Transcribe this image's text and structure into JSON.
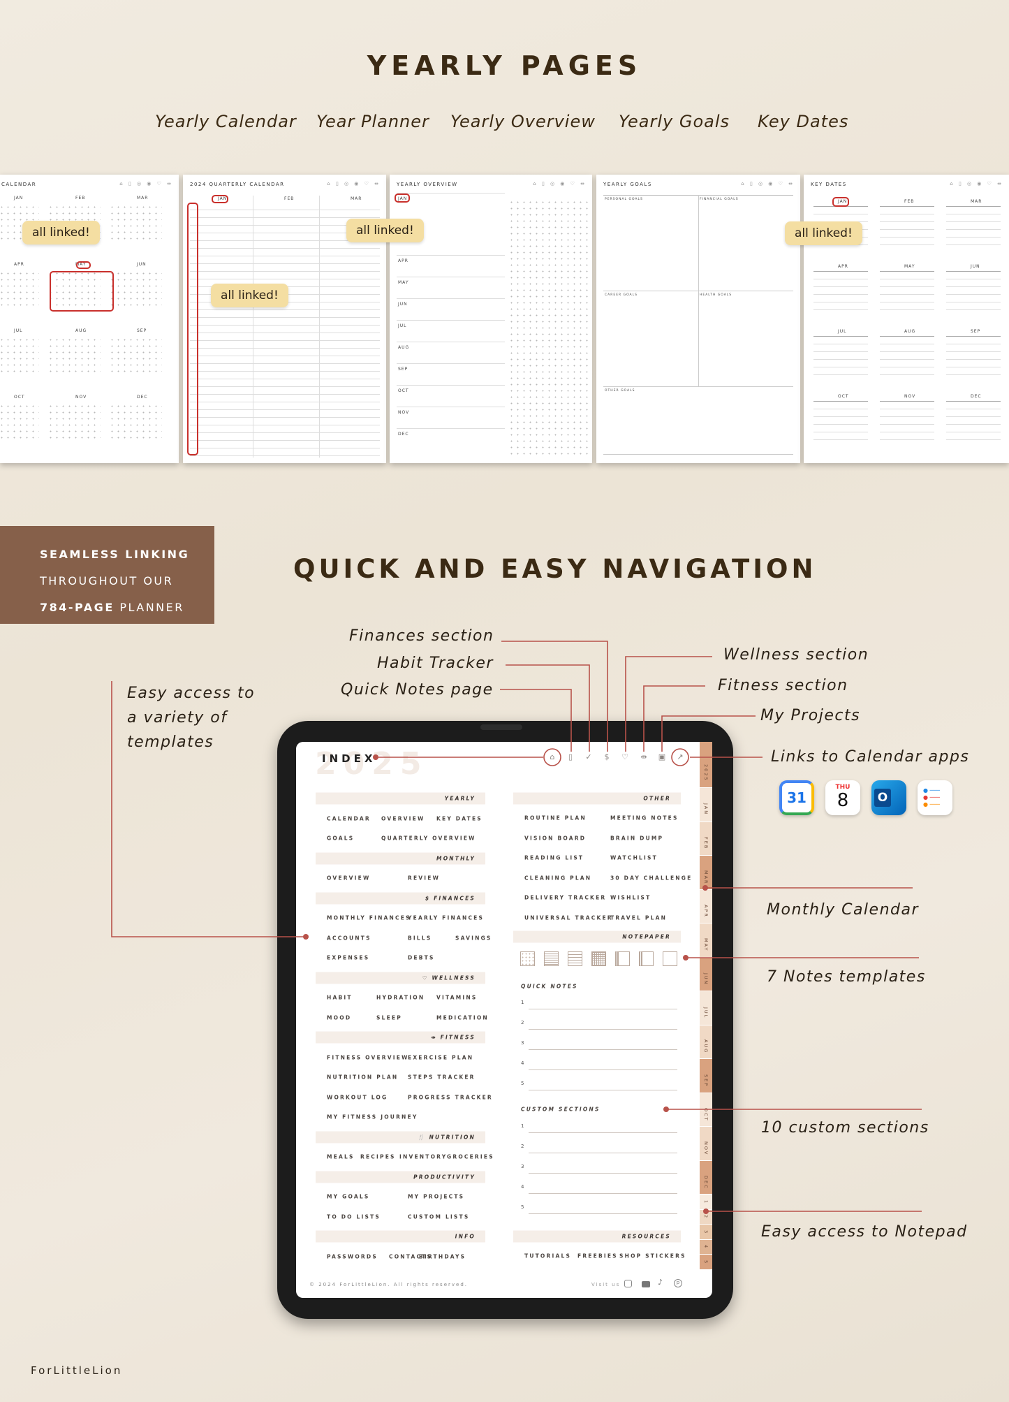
{
  "yearly": {
    "title": "YEARLY PAGES",
    "subtitles": [
      "Yearly Calendar",
      "Year Planner",
      "Yearly Overview",
      "Yearly Goals",
      "Key Dates"
    ],
    "bubble": "all linked!",
    "pages": {
      "calendar": {
        "title": "CALENDAR",
        "months": [
          "JAN",
          "FEB",
          "MAR",
          "APR",
          "MAY",
          "JUN",
          "JUL",
          "AUG",
          "SEP",
          "OCT",
          "NOV",
          "DEC"
        ]
      },
      "quarterly": {
        "title": "2024 QUARTERLY CALENDAR",
        "months": [
          "JAN",
          "FEB",
          "MAR"
        ]
      },
      "overview": {
        "title": "YEARLY OVERVIEW",
        "months": [
          "JAN",
          "APR",
          "MAY",
          "JUN",
          "JUL",
          "AUG",
          "SEP",
          "OCT",
          "NOV",
          "DEC"
        ]
      },
      "goals": {
        "title": "YEARLY GOALS",
        "boxes": [
          "PERSONAL GOALS",
          "FINANCIAL GOALS",
          "CAREER GOALS",
          "HEALTH GOALS",
          "OTHER GOALS"
        ]
      },
      "keydates": {
        "title": "KEY DATES",
        "months": [
          "JAN",
          "FEB",
          "MAR",
          "APR",
          "MAY",
          "JUN",
          "JUL",
          "AUG",
          "SEP",
          "OCT",
          "NOV",
          "DEC"
        ]
      }
    }
  },
  "promo": {
    "line1": "SEAMLESS LINKING",
    "line2": "THROUGHOUT OUR",
    "line3_bold": "784-PAGE",
    "line3_rest": " PLANNER"
  },
  "navigation": {
    "title": "QUICK AND EASY NAVIGATION",
    "callouts": {
      "finances": "Finances section",
      "habit": "Habit Tracker",
      "quick_notes": "Quick Notes page",
      "wellness": "Wellness section",
      "fitness": "Fitness section",
      "projects": "My Projects",
      "calendar_apps": "Links to Calendar apps",
      "templates": [
        "Easy access to",
        "a variety of",
        "templates"
      ],
      "monthly": "Monthly Calendar",
      "notes_templates": "7 Notes templates",
      "custom": "10 custom sections",
      "notepad": "Easy access to Notepad"
    },
    "calendar_apps": {
      "google": "31",
      "apple_day": "THU",
      "apple_date": "8",
      "outlook": "O"
    }
  },
  "index": {
    "title": "INDEX",
    "year_watermark": "2025",
    "nav_icons": [
      "home-icon",
      "document-icon",
      "check-circle-icon",
      "dollar-icon",
      "heart-icon",
      "dumbbell-icon",
      "briefcase-icon",
      "external-link-icon"
    ],
    "left": [
      {
        "header": "YEARLY"
      },
      {
        "items": [
          "CALENDAR",
          "OVERVIEW",
          "KEY DATES"
        ]
      },
      {
        "items": [
          "GOALS",
          "QUARTERLY OVERVIEW"
        ]
      },
      {
        "header": "MONTHLY"
      },
      {
        "items": [
          "OVERVIEW",
          "REVIEW"
        ]
      },
      {
        "header": "$ FINANCES"
      },
      {
        "items": [
          "MONTHLY FINANCES",
          "YEARLY FINANCES"
        ]
      },
      {
        "items": [
          "ACCOUNTS",
          "BILLS",
          "SAVINGS"
        ]
      },
      {
        "items": [
          "EXPENSES",
          "DEBTS"
        ]
      },
      {
        "header": "♡ WELLNESS"
      },
      {
        "items": [
          "HABIT",
          "HYDRATION",
          "VITAMINS"
        ]
      },
      {
        "items": [
          "MOOD",
          "SLEEP",
          "MEDICATION"
        ]
      },
      {
        "header": "⇹ FITNESS"
      },
      {
        "items": [
          "FITNESS OVERVIEW",
          "EXERCISE PLAN"
        ]
      },
      {
        "items": [
          "NUTRITION PLAN",
          "STEPS TRACKER"
        ]
      },
      {
        "items": [
          "WORKOUT LOG",
          "PROGRESS TRACKER"
        ]
      },
      {
        "items": [
          "MY FITNESS JOURNEY"
        ]
      },
      {
        "header": "🍴 NUTRITION"
      },
      {
        "items": [
          "MEALS",
          "RECIPES",
          "INVENTORY",
          "GROCERIES"
        ]
      },
      {
        "header": "PRODUCTIVITY"
      },
      {
        "items": [
          "MY GOALS",
          "MY PROJECTS"
        ]
      },
      {
        "items": [
          "TO DO LISTS",
          "CUSTOM LISTS"
        ]
      },
      {
        "header": "INFO"
      },
      {
        "items": [
          "PASSWORDS",
          "CONTACTS",
          "BIRTHDAYS"
        ]
      }
    ],
    "other": {
      "header": "OTHER",
      "rows": [
        [
          "ROUTINE PLAN",
          "MEETING NOTES"
        ],
        [
          "VISION BOARD",
          "BRAIN DUMP"
        ],
        [
          "READING LIST",
          "WATCHLIST"
        ],
        [
          "CLEANING PLAN",
          "30 DAY CHALLENGE"
        ],
        [
          "DELIVERY TRACKER",
          "WISHLIST"
        ],
        [
          "UNIVERSAL TRACKER",
          "TRAVEL PLAN"
        ]
      ]
    },
    "notepaper": {
      "header": "NOTEPAPER",
      "templates": [
        "dot-grid",
        "lined-narrow",
        "lined-wide",
        "grid",
        "cornell",
        "cornell-wide",
        "blank"
      ]
    },
    "quick_notes": {
      "label": "QUICK NOTES",
      "numbers": [
        "1",
        "2",
        "3",
        "4",
        "5"
      ]
    },
    "custom_sections": {
      "label": "CUSTOM SECTIONS",
      "numbers": [
        "1",
        "2",
        "3",
        "4",
        "5"
      ]
    },
    "resources": {
      "header": "RESOURCES",
      "items": [
        "TUTORIALS",
        "FREEBIES",
        "SHOP STICKERS"
      ]
    },
    "footer": {
      "copyright": "© 2024 ForLittleLion. All rights reserved.",
      "visit": "Visit us"
    },
    "tabs": [
      "2025",
      "JAN",
      "FEB",
      "MAR",
      "APR",
      "MAY",
      "JUN",
      "JUL",
      "AUG",
      "SEP",
      "OCT",
      "NOV",
      "DEC",
      "1",
      "2",
      "3",
      "4",
      "5"
    ]
  },
  "brand": "ForLittleLion",
  "colors": {
    "accent_line": "#b8524a",
    "brown": "#86604a",
    "bubble": "#f4dea2",
    "title": "#3b2a14"
  }
}
